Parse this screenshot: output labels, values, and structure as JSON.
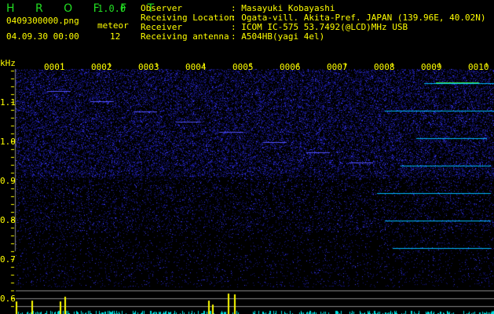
{
  "app": {
    "name": "H R O F F T",
    "version": "1.0.0"
  },
  "file": {
    "name": "0409300000.png",
    "datetime": "04.09.30 00:00"
  },
  "meteor": {
    "label": "meteor",
    "count": "12"
  },
  "info": [
    {
      "label": "Observer",
      "value": ": Masayuki Kobayashi"
    },
    {
      "label": "Receiving Location",
      "value": ": Ogata-vill. Akita-Pref. JAPAN (139.96E, 40.02N)"
    },
    {
      "label": "Receiver",
      "value": ": ICOM IC-575 53.7492(@LCD)MHz USB"
    },
    {
      "label": "Receiving antenna",
      "value": ": A504HB(yagi 4el)"
    }
  ],
  "axis": {
    "unit": "kHz",
    "yticks": [
      "1.1",
      "1.0",
      "0.9",
      "0.8",
      "0.7",
      "0.6"
    ],
    "minutes": [
      "0001",
      "0002",
      "0003",
      "0004",
      "0005",
      "0006",
      "0007",
      "0008",
      "0009",
      "0010"
    ]
  },
  "colors": {
    "text": "#ffff00",
    "logo": "#22dd22",
    "signal": "#00ffff",
    "noise": "#1a1aa0"
  }
}
